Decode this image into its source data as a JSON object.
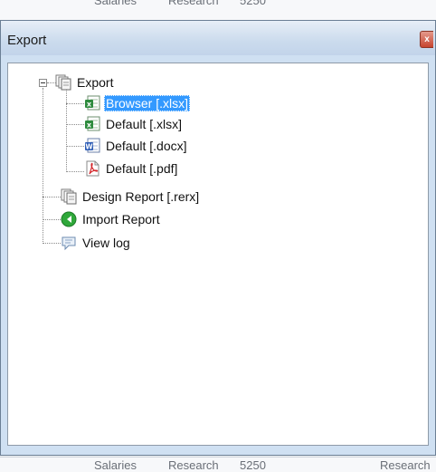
{
  "background": {
    "top_row": [
      "Salaries",
      "Research",
      "5250"
    ],
    "bottom_row": [
      "Salaries",
      "Research",
      "5250",
      "Research"
    ]
  },
  "window": {
    "title": "Export",
    "close_label": "x"
  },
  "tree": {
    "root": {
      "label": "Export",
      "icon": "documents-icon",
      "expanded": true
    },
    "export_children": [
      {
        "label": "Browser [.xlsx]",
        "icon": "excel-icon",
        "selected": true
      },
      {
        "label": "Default [.xlsx]",
        "icon": "excel-icon",
        "selected": false
      },
      {
        "label": "Default [.docx]",
        "icon": "word-icon",
        "selected": false
      },
      {
        "label": "Default [.pdf]",
        "icon": "pdf-icon",
        "selected": false
      }
    ],
    "items": [
      {
        "label": "Design Report [.rerx]",
        "icon": "documents-icon"
      },
      {
        "label": "Import Report",
        "icon": "import-arrow-icon"
      },
      {
        "label": "View log",
        "icon": "speech-bubble-icon"
      }
    ]
  },
  "colors": {
    "selection": "#3399ff",
    "excel": "#2e8b3e",
    "word": "#2b5bb5",
    "pdf": "#d4262b",
    "import": "#2fa83a"
  }
}
